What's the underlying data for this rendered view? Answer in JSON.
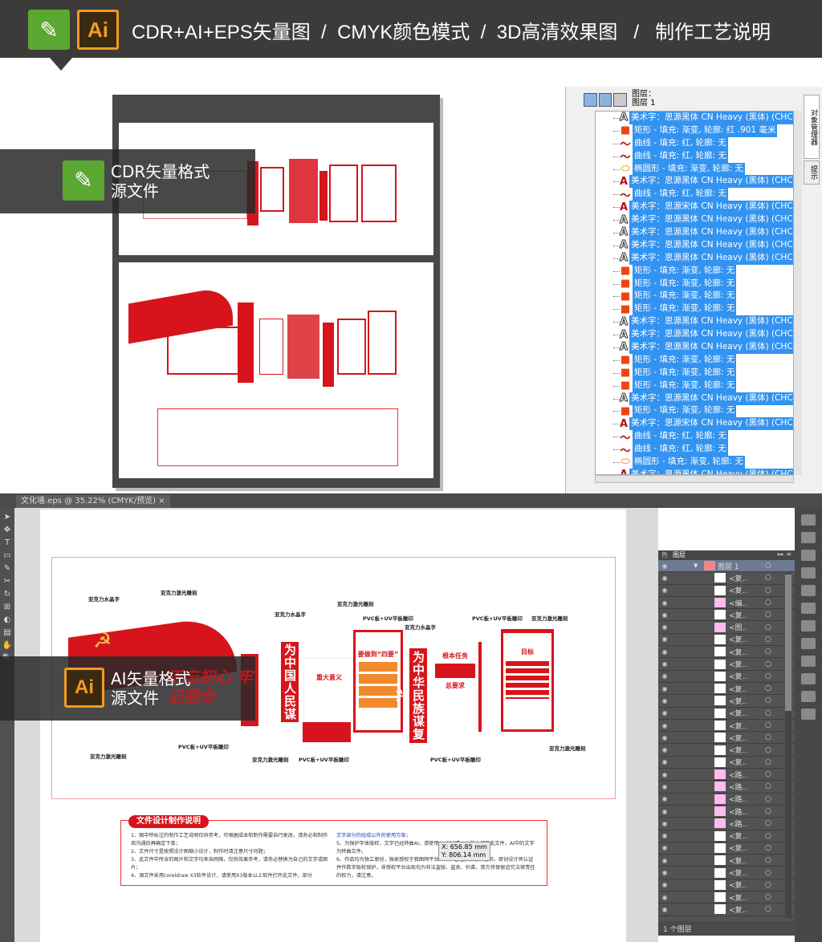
{
  "header": {
    "title": "CDR+AI+EPS矢量图  /  CMYK颜色模式  /  3D高清效果图   /   制作工艺说明",
    "cdr_icon": "coreldraw-logo-icon",
    "ai_icon": "illustrator-logo-icon",
    "ai_logo_text": "Ai"
  },
  "cdr_label": {
    "text": "CDR矢量格式\n源文件"
  },
  "ai_label": {
    "text": "AI矢量格式\n源文件",
    "logo": "Ai"
  },
  "cdr_panel": {
    "header_line1": "图层：",
    "header_line2": "图层 1",
    "side_tab1": "对象管理器",
    "side_tab2": "提示",
    "rows": [
      [
        "A-outline",
        "美术字：思源黑体 CN Heavy (黑体) (CHC) -"
      ],
      [
        "rect",
        "矩形 - 填充: 渐变, 轮廓: 红 .901 毫米"
      ],
      [
        "curve",
        "曲线 - 填充: 红, 轮廓: 无"
      ],
      [
        "curve",
        "曲线 - 填充: 红, 轮廓: 无"
      ],
      [
        "ellipse",
        "椭圆形 - 填充: 渐变, 轮廓: 无"
      ],
      [
        "A-red",
        "美术字：思源黑体 CN Heavy (黑体) (CHC) -"
      ],
      [
        "curve",
        "曲线 - 填充: 红, 轮廓: 无"
      ],
      [
        "A-red",
        "美术字：思源宋体 CN Heavy (黑体) (CHC) -"
      ],
      [
        "A-outline",
        "美术字：思源黑体 CN Heavy (黑体) (CHC) -"
      ],
      [
        "A-outline",
        "美术字：思源黑体 CN Heavy (黑体) (CHC) -"
      ],
      [
        "A-outline",
        "美术字：思源黑体 CN Heavy (黑体) (CHC) -"
      ],
      [
        "A-outline",
        "美术字：思源黑体 CN Heavy (黑体) (CHC) -"
      ],
      [
        "rect",
        "矩形 - 填充: 渐变, 轮廓: 无"
      ],
      [
        "rect",
        "矩形 - 填充: 渐变, 轮廓: 无"
      ],
      [
        "rect",
        "矩形 - 填充: 渐变, 轮廓: 无"
      ],
      [
        "rect",
        "矩形 - 填充: 渐变, 轮廓: 无"
      ],
      [
        "A-outline",
        "美术字：思源黑体 CN Heavy (黑体) (CHC) -"
      ],
      [
        "A-outline",
        "美术字：思源黑体 CN Heavy (黑体) (CHC) -"
      ],
      [
        "A-outline",
        "美术字：思源黑体 CN Heavy (黑体) (CHC) -"
      ],
      [
        "rect",
        "矩形 - 填充: 渐变, 轮廓: 无"
      ],
      [
        "rect",
        "矩形 - 填充: 渐变, 轮廓: 无"
      ],
      [
        "rect",
        "矩形 - 填充: 渐变, 轮廓: 无"
      ],
      [
        "A-outline",
        "美术字：思源黑体 CN Heavy (黑体) (CHC) -"
      ],
      [
        "rect",
        "矩形 - 填充: 渐变, 轮廓: 无"
      ],
      [
        "A-red",
        "美术字：思源宋体 CN Heavy (黑体) (CHC) -"
      ],
      [
        "curve",
        "曲线 - 填充: 红, 轮廓: 无"
      ],
      [
        "curve",
        "曲线 - 填充: 红, 轮廓: 无"
      ],
      [
        "ellipse",
        "椭圆形 - 填充: 渐变, 轮廓: 无"
      ],
      [
        "A-red",
        "美术字：思源黑体 CN Heavy (黑体) (CHC) -"
      ]
    ]
  },
  "ai_window": {
    "tab_title": "文化墙.eps @ 35.22% (CMYK/预览)",
    "tab_close": "×"
  },
  "ai_layers": {
    "tabs": [
      "色",
      "图层",
      "",
      "",
      "",
      ""
    ],
    "layer_name": "图层 1",
    "footer": "1 个图层",
    "rows": [
      "<复..",
      "<复..",
      "<编..",
      "<复..",
      "<图..",
      "<复..",
      "<复..",
      "<复..",
      "<复..",
      "<复..",
      "<复..",
      "<复..",
      "<复..",
      "<复..",
      "<复..",
      "<复..",
      "<路..",
      "<路..",
      "<路..",
      "<路..",
      "<路..",
      "<复..",
      "<复..",
      "<复..",
      "<复..",
      "<复..",
      "<复..",
      "<复.."
    ]
  },
  "artwork": {
    "slogan_1": "为中国人民谋幸福",
    "slogan_2": "为中华民族谋复兴",
    "headline": "不忘初心 牢记使命",
    "panel_titles": [
      "重大意义",
      "要做到“四要”",
      "根本任务",
      "总要求",
      "目标"
    ],
    "callouts": [
      "亚克力水晶字",
      "亚克力激光雕刻",
      "亚克力水晶字",
      "亚克力激光雕刻",
      "PVC板+UV平板雕印",
      "亚克力水晶字",
      "PVC板+UV平板雕印",
      "亚克力激光雕刻",
      "亚克力激光雕刻",
      "PVC板+UV平板雕印",
      "亚克力激光雕刻",
      "PVC板+UV平板雕印",
      "PVC板+UV平板雕印",
      "亚克力激光雕刻"
    ]
  },
  "description": {
    "title": "文件设计制作说明",
    "left": [
      "1、图中所标注的制作工艺说明仅供参考，可根据成本和制作需要自行更改，请务必和制作商沟通后再确定下单；",
      "2、文件尺寸是按照设计图缩小设计，制作时请注意尺寸问题；",
      "3、此文件中所含的图片和文字均来自网络，仅供效果参考，请务必替换为自己的文字或图片；",
      "4、源文件采用coreldraw X3软件设计，请使用X3版本以上软件打开此文件，部分"
    ],
    "right": [
      "文字部分的组成以外的使用方案；",
      "5、为保护字体版权，文字已经转曲AI，请使用AI CS6或以上版本打开此文件，AI中的文字为转曲文件。",
      "6、作品均为独立原创，独家授权于我图网平台出售，已经获得版权证明，原创设计师认证并作数字版权保护，非授权平台出现均为非法盗版、盗卖、抄袭，我方将保留追究法律责任的权力，请注意。"
    ]
  },
  "tooltip": {
    "x": "X: 656.85 mm",
    "y": "Y: 806.14 mm"
  },
  "colors": {
    "header_bg": "#3d3b3a",
    "selection": "#3393f0",
    "accent_red": "#d7141b",
    "ai_panel": "#535353"
  }
}
